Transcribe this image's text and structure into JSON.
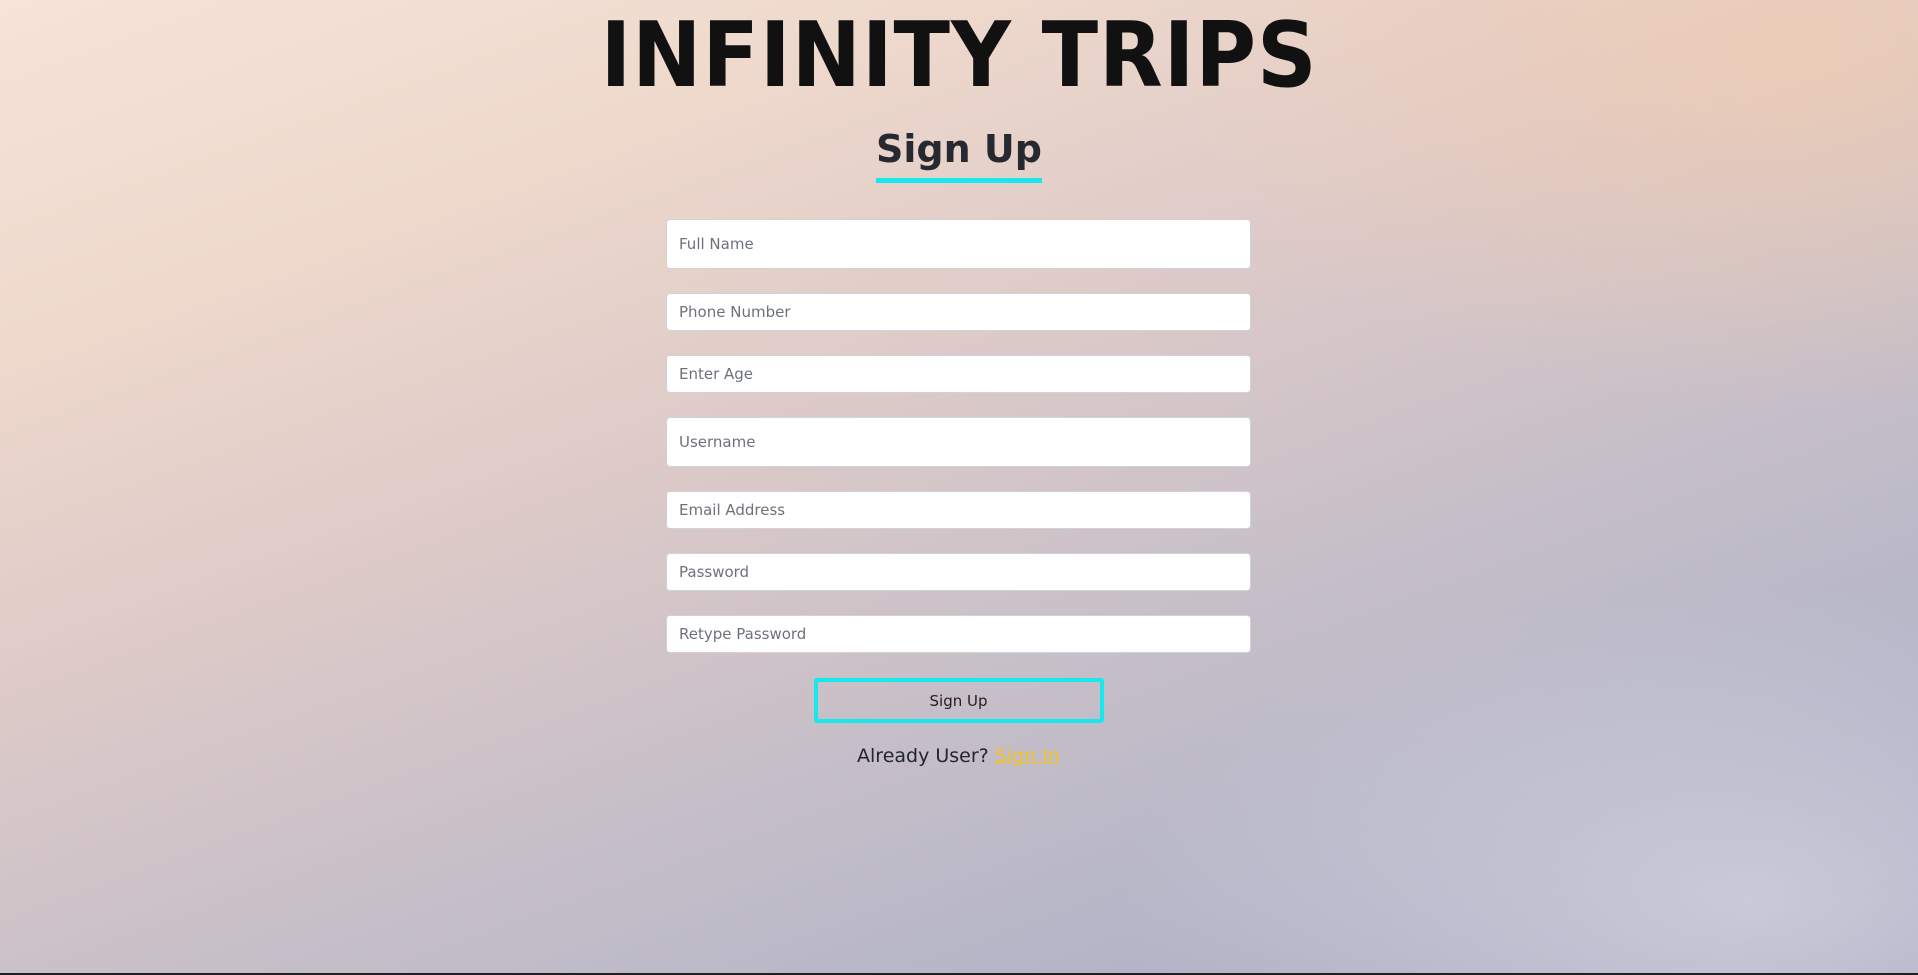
{
  "brand": {
    "title": "INFINITY TRIPS"
  },
  "page": {
    "heading": "Sign Up"
  },
  "form": {
    "full_name": {
      "placeholder": "Full Name",
      "value": ""
    },
    "phone": {
      "placeholder": "Phone Number",
      "value": ""
    },
    "age": {
      "placeholder": "Enter Age",
      "value": ""
    },
    "username": {
      "placeholder": "Username",
      "value": ""
    },
    "email": {
      "placeholder": "Email Address",
      "value": ""
    },
    "password": {
      "placeholder": "Password",
      "value": ""
    },
    "retype_password": {
      "placeholder": "Retype Password",
      "value": ""
    },
    "submit_label": "Sign Up"
  },
  "footer": {
    "prompt": "Already User?",
    "link_label": "Sign In"
  },
  "colors": {
    "accent": "#18e8ee",
    "link": "#f3c623",
    "text": "#262a30"
  }
}
